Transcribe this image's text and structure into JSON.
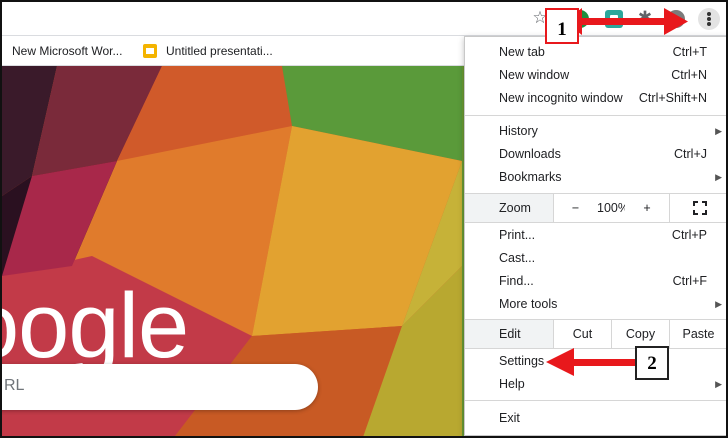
{
  "browser": {
    "toolbar": {
      "star_icon": "☆",
      "puzzle_icon": "✱"
    },
    "bookmarks": [
      {
        "label": "New Microsoft Wor..."
      },
      {
        "label": "Untitled presentati..."
      }
    ]
  },
  "page": {
    "logo_fragment": "oogle",
    "search_placeholder": "RL"
  },
  "menu": {
    "new_tab": {
      "label": "New tab",
      "shortcut": "Ctrl+T"
    },
    "new_window": {
      "label": "New window",
      "shortcut": "Ctrl+N"
    },
    "new_incognito": {
      "label": "New incognito window",
      "shortcut": "Ctrl+Shift+N"
    },
    "history": {
      "label": "History"
    },
    "downloads": {
      "label": "Downloads",
      "shortcut": "Ctrl+J"
    },
    "bookmarks": {
      "label": "Bookmarks"
    },
    "zoom": {
      "label": "Zoom",
      "minus": "−",
      "level": "100%",
      "plus": "+"
    },
    "print": {
      "label": "Print...",
      "shortcut": "Ctrl+P"
    },
    "cast": {
      "label": "Cast..."
    },
    "find": {
      "label": "Find...",
      "shortcut": "Ctrl+F"
    },
    "more_tools": {
      "label": "More tools"
    },
    "edit": {
      "label": "Edit",
      "cut": "Cut",
      "copy": "Copy",
      "paste": "Paste"
    },
    "settings": {
      "label": "Settings"
    },
    "help": {
      "label": "Help"
    },
    "exit": {
      "label": "Exit"
    },
    "submenu_arrow": "▶"
  },
  "annotations": {
    "step1": "1",
    "step2": "2",
    "color": "#e8181c"
  },
  "colors": {
    "menu_bg": "#ffffff",
    "zoom_row_bg": "#f1f3f4",
    "green_extension": "#1e8e3e",
    "teal_extension": "#2aa79b",
    "slides_icon": "#f4b400"
  }
}
